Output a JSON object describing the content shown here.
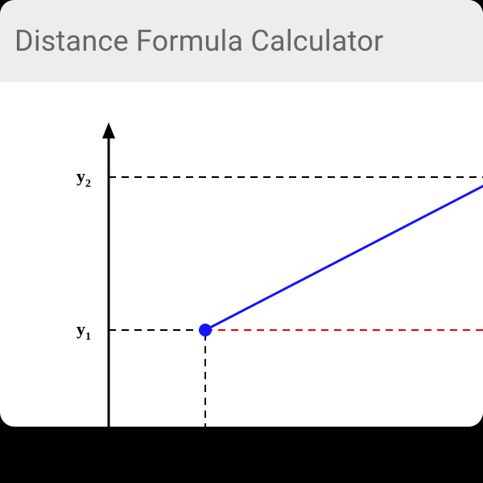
{
  "header": {
    "title": "Distance Formula Calculator"
  },
  "diagram": {
    "y_label_upper": "y",
    "y_label_upper_sub": "2",
    "y_label_lower": "y",
    "y_label_lower_sub": "1",
    "colors": {
      "axis": "#000000",
      "dash": "#000000",
      "hypotenuse": "#1111ff",
      "horizontal_leg": "#ee0000",
      "point_fill": "#1111ff"
    }
  }
}
